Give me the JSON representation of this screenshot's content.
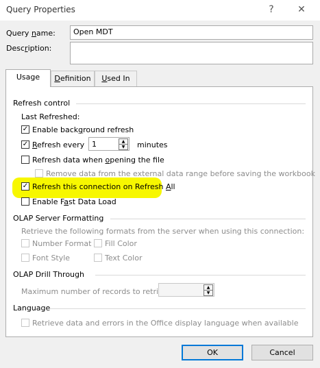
{
  "window": {
    "title": "Query Properties",
    "help_glyph": "?",
    "close_glyph": "✕"
  },
  "query_name": {
    "label_pre": "Query ",
    "label_u": "n",
    "label_post": "ame:",
    "value": "Open MDT"
  },
  "description": {
    "label_pre": "Desc",
    "label_u": "r",
    "label_post": "iption:",
    "value": ""
  },
  "tabs": [
    {
      "label": "Usage"
    },
    {
      "label_u": "D",
      "label_post": "efinition"
    },
    {
      "label_u": "U",
      "label_post": "sed In"
    }
  ],
  "refresh_control": {
    "heading": "Refresh control",
    "last_refreshed": "Last Refreshed:",
    "background": {
      "pre": "Enable back",
      "u": "g",
      "post": "round refresh",
      "checked": true
    },
    "every": {
      "u": "R",
      "post": "efresh every",
      "checked": true,
      "value": "1",
      "unit": "minutes"
    },
    "on_open": {
      "pre": "Refresh data when ",
      "u": "o",
      "post": "pening the file",
      "checked": false
    },
    "remove_data": {
      "label": "Remove data from the external data range before saving the workbook",
      "checked": false
    },
    "refresh_all": {
      "pre": "Refresh this connection on Refresh ",
      "u": "A",
      "post": "ll",
      "checked": true
    },
    "fast_load": {
      "pre": "Enable F",
      "u": "a",
      "post": "st Data Load",
      "checked": false
    }
  },
  "olap_formatting": {
    "heading": "OLAP Server Formatting",
    "desc": "Retrieve the following formats from the server when using this connection:",
    "number_format": "Number Format",
    "fill_color": "Fill Color",
    "font_style": "Font Style",
    "text_color": "Text Color"
  },
  "olap_drill": {
    "heading": "OLAP Drill Through",
    "max_records": "Maximum number of records to retrieve:",
    "value": ""
  },
  "language": {
    "heading": "Language",
    "retrieve": "Retrieve data and errors in the Office display language when available"
  },
  "buttons": {
    "ok": "OK",
    "cancel": "Cancel"
  },
  "colors": {
    "highlight": "#f7f700",
    "accent": "#0078d7"
  },
  "check_glyph": "✓",
  "spin_up": "▲",
  "spin_down": "▼"
}
